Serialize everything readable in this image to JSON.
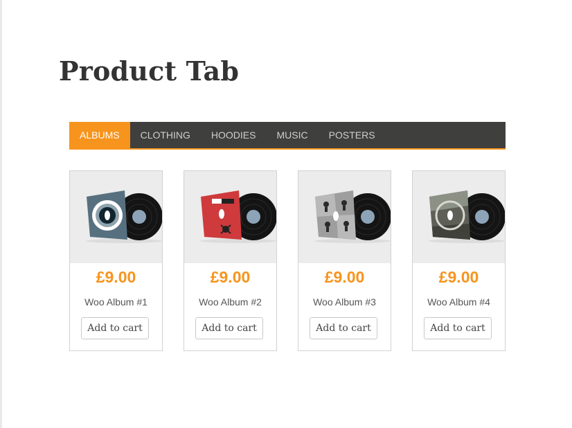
{
  "page": {
    "title": "Product Tab"
  },
  "tabs": [
    {
      "label": "ALBUMS",
      "active": true
    },
    {
      "label": "CLOTHING",
      "active": false
    },
    {
      "label": "HOODIES",
      "active": false
    },
    {
      "label": "MUSIC",
      "active": false
    },
    {
      "label": "POSTERS",
      "active": false
    }
  ],
  "products": [
    {
      "price": "£9.00",
      "name": "Woo Album #1",
      "button": "Add to cart",
      "image": "vinyl-record-blue-cover"
    },
    {
      "price": "£9.00",
      "name": "Woo Album #2",
      "button": "Add to cart",
      "image": "vinyl-record-red-cover"
    },
    {
      "price": "£9.00",
      "name": "Woo Album #3",
      "button": "Add to cart",
      "image": "vinyl-record-grey-cover"
    },
    {
      "price": "£9.00",
      "name": "Woo Album #4",
      "button": "Add to cart",
      "image": "vinyl-record-photo-cover"
    }
  ],
  "colors": {
    "accent": "#f7941d",
    "tabbar": "#3f3f3d",
    "title": "#333333"
  }
}
